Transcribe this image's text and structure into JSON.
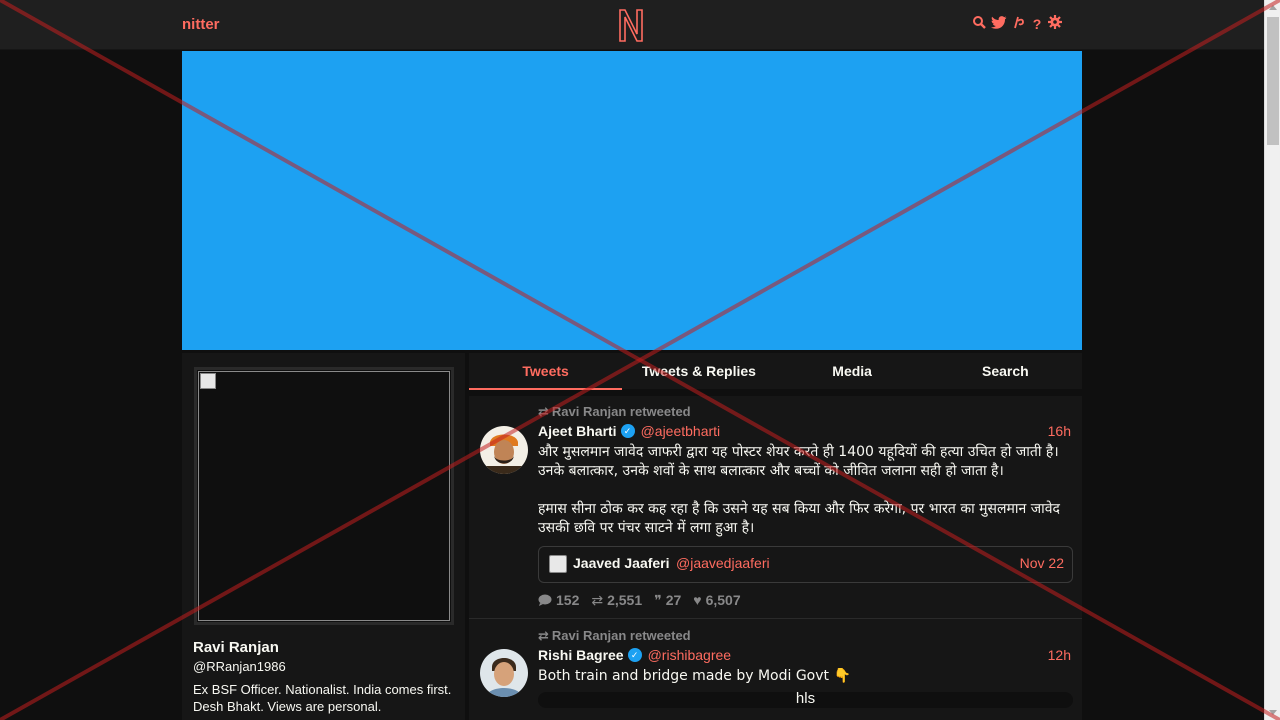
{
  "navbar": {
    "brand": "nitter",
    "icons": [
      "search-icon",
      "twitter-icon",
      "rss-icon",
      "help-icon",
      "gear-icon"
    ]
  },
  "profile": {
    "name": "Ravi Ranjan",
    "handle": "@RRanjan1986",
    "bio": "Ex BSF Officer. Nationalist. India comes first. Desh Bhakt. Views are personal."
  },
  "tabs": [
    {
      "label": "Tweets",
      "active": true
    },
    {
      "label": "Tweets & Replies",
      "active": false
    },
    {
      "label": "Media",
      "active": false
    },
    {
      "label": "Search",
      "active": false
    }
  ],
  "tweets": [
    {
      "retweet_label": "Ravi Ranjan retweeted",
      "fullname": "Ajeet Bharti",
      "username": "@ajeetbharti",
      "date": "16h",
      "content_p1": "और मुसलमान जावेद जाफरी द्वारा यह पोस्टर शेयर करते ही 1400 यहूदियों की हत्या उचित हो जाती है। उनके बलात्कार, उनके शवों के साथ बलात्कार और बच्चों को जीवित जलाना सही हो जाता है।",
      "content_p2": "हमास सीना ठोक कर कह रहा है कि उसने यह सब किया और फिर करेगा, पर भारत का मुसलमान जावेद उसकी छवि पर पंचर साटने में लगा हुआ है।",
      "quote": {
        "fullname": "Jaaved Jaaferi",
        "username": "@jaavedjaaferi",
        "date": "Nov 22"
      },
      "stats": {
        "replies": "152",
        "retweets": "2,551",
        "quotes": "27",
        "likes": "6,507"
      }
    },
    {
      "retweet_label": "Ravi Ranjan retweeted",
      "fullname": "Rishi Bagree",
      "username": "@rishibagree",
      "date": "12h",
      "content": "Both train and bridge made by Modi Govt 👇",
      "card_text": "hls"
    }
  ],
  "colors": {
    "accent": "#ff6c60",
    "banner": "#1da1f2",
    "background": "#0f0f0f",
    "panel": "#161616"
  }
}
